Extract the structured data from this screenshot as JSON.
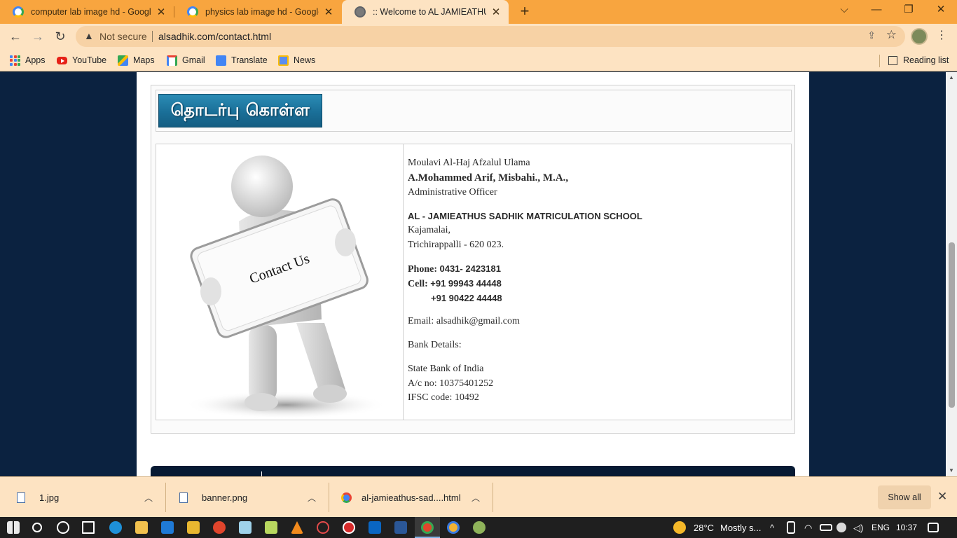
{
  "browser": {
    "tabs": [
      {
        "title": "computer lab image hd - Google",
        "favicon": "google-icon",
        "active": false
      },
      {
        "title": "physics lab image hd - Google Se",
        "favicon": "google-icon",
        "active": false
      },
      {
        "title": ":: Welcome to AL JAMIEATHUS SA",
        "favicon": "globe-icon",
        "active": true
      }
    ],
    "new_tab_symbol": "+",
    "window_controls": {
      "dropdown": "⌵",
      "minimize": "—",
      "restore": "❐",
      "close": "✕"
    },
    "toolbar": {
      "back": "←",
      "forward": "→",
      "reload": "↻",
      "security_label": "Not secure",
      "url": "alsadhik.com/contact.html"
    },
    "bookmarks": [
      {
        "label": "Apps",
        "icon": "apps-grid-icon"
      },
      {
        "label": "YouTube",
        "icon": "youtube-icon"
      },
      {
        "label": "Maps",
        "icon": "maps-icon"
      },
      {
        "label": "Gmail",
        "icon": "gmail-icon"
      },
      {
        "label": "Translate",
        "icon": "translate-icon"
      },
      {
        "label": "News",
        "icon": "news-icon"
      }
    ],
    "reading_list": "Reading list"
  },
  "page": {
    "banner_text": "தொடர்பு கொள்ள",
    "image_sign_text": "Contact Us",
    "contact": {
      "title_line": "Moulavi Al-Haj Afzalul Ulama",
      "name": "A.Mohammed Arif, Misbahi., M.A.,",
      "role": "Administrative Officer",
      "school": "AL - JAMIEATHUS SADHIK MATRICULATION SCHOOL",
      "address1": "Kajamalai,",
      "address2": "Trichirappalli - 620 023.",
      "phone_label": "Phone:",
      "phone": "0431- 2423181",
      "cell_label": "Cell:",
      "cell1": "+91 99943 44448",
      "cell2": "+91 90422 44448",
      "email": "Email: alsadhik@gmail.com",
      "bank_heading": "Bank Details:",
      "bank_name": "State Bank of India",
      "account": "A/c no: 10375401252",
      "ifsc": "IFSC code: 10492"
    }
  },
  "downloads": {
    "items": [
      {
        "name": "1.jpg",
        "icon": "image-file-icon"
      },
      {
        "name": "banner.png",
        "icon": "image-file-icon"
      },
      {
        "name": "al-jamieathus-sad....html",
        "icon": "chrome-file-icon"
      }
    ],
    "show_all": "Show all"
  },
  "taskbar": {
    "weather_temp": "28°C",
    "weather_text": "Mostly s...",
    "language": "ENG",
    "time": "10:37"
  },
  "colors": {
    "tab_strip": "#f8a53f",
    "toolbar": "#fde3c2",
    "page_background": "#0b2240",
    "banner_blue": "#1a6f98"
  }
}
